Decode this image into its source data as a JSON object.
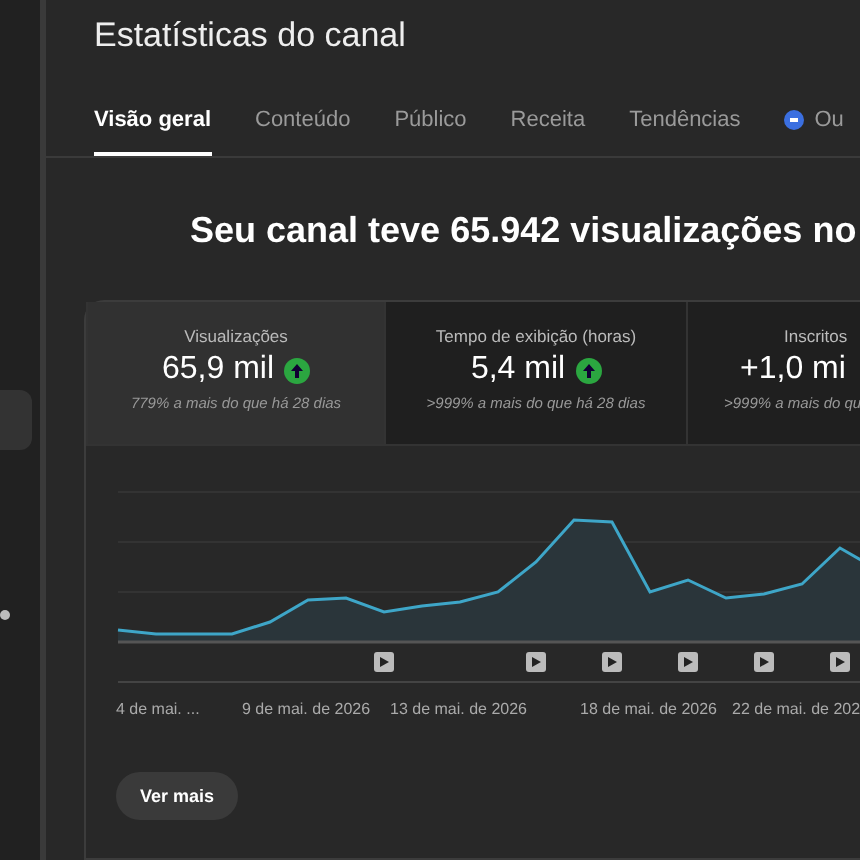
{
  "page": {
    "title": "Estatísticas do canal"
  },
  "tabs": [
    {
      "label": "Visão geral",
      "selected": true
    },
    {
      "label": "Conteúdo",
      "selected": false
    },
    {
      "label": "Público",
      "selected": false
    },
    {
      "label": "Receita",
      "selected": false
    },
    {
      "label": "Tendências",
      "selected": false
    },
    {
      "label": "Ou",
      "selected": false,
      "kind": "icon"
    }
  ],
  "headline": "Seu canal teve 65.942 visualizações no",
  "metrics": [
    {
      "label": "Visualizações",
      "value": "65,9 mil",
      "trend_up": true,
      "comparison": "779% a mais do que há 28 dias",
      "selected": true
    },
    {
      "label": "Tempo de exibição (horas)",
      "value": "5,4 mil",
      "trend_up": true,
      "comparison": ">999% a mais do que há 28 dias",
      "selected": false
    },
    {
      "label": "Inscritos",
      "value": "+1,0 mi",
      "trend_up": false,
      "comparison": ">999% a mais do qu",
      "selected": false
    }
  ],
  "x_labels": [
    "4 de mai. ...",
    "9 de mai. de 2026",
    "13 de mai. de 2026",
    "18 de mai. de 2026",
    "22 de mai. de 202"
  ],
  "more_button": "Ver mais"
}
